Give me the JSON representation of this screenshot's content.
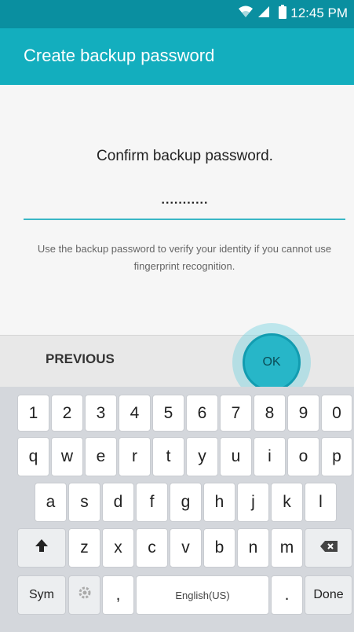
{
  "status_bar": {
    "time": "12:45 PM",
    "icons": [
      "wifi-icon",
      "signal-icon",
      "battery-icon"
    ]
  },
  "app_bar": {
    "title": "Create backup password"
  },
  "content": {
    "prompt": "Confirm backup password.",
    "password_value": "...........",
    "helper_text": "Use the backup password to verify your identity if you cannot use fingerprint recognition."
  },
  "actions": {
    "previous_label": "PREVIOUS",
    "ok_label": "OK"
  },
  "keyboard": {
    "row_numbers": [
      "1",
      "2",
      "3",
      "4",
      "5",
      "6",
      "7",
      "8",
      "9",
      "0"
    ],
    "row_q": [
      "q",
      "w",
      "e",
      "r",
      "t",
      "y",
      "u",
      "i",
      "o",
      "p"
    ],
    "row_a": [
      "a",
      "s",
      "d",
      "f",
      "g",
      "h",
      "j",
      "k",
      "l"
    ],
    "row_z": [
      "z",
      "x",
      "c",
      "v",
      "b",
      "n",
      "m"
    ],
    "sym_label": "Sym",
    "comma_label": ",",
    "space_label": "English(US)",
    "period_label": ".",
    "done_label": "Done",
    "shift_icon": "shift-icon",
    "backspace_icon": "backspace-icon",
    "settings_icon": "gear-icon"
  },
  "colors": {
    "status_bar": "#0a8fa0",
    "app_bar": "#13aebe",
    "accent": "#27b6c8"
  }
}
